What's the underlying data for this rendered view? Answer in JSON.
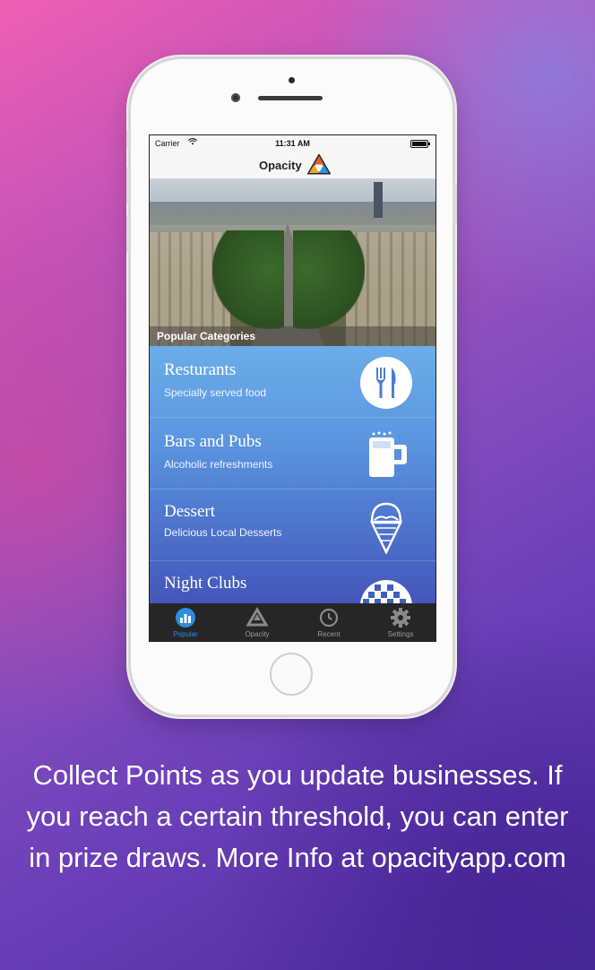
{
  "status_bar": {
    "carrier": "Carrier",
    "time": "11:31 AM"
  },
  "app": {
    "title": "Opacity"
  },
  "hero": {
    "caption": "Popular Categories"
  },
  "categories": [
    {
      "title": "Resturants",
      "subtitle": "Specially served food",
      "icon": "utensils-icon"
    },
    {
      "title": "Bars and Pubs",
      "subtitle": "Alcoholic refreshments",
      "icon": "beer-mug-icon"
    },
    {
      "title": "Dessert",
      "subtitle": "Delicious Local Desserts",
      "icon": "ice-cream-icon"
    },
    {
      "title": "Night Clubs",
      "subtitle": "",
      "icon": "disco-ball-icon"
    }
  ],
  "tabs": [
    {
      "label": "Popular",
      "icon": "popular-icon",
      "active": true
    },
    {
      "label": "Opacity",
      "icon": "opacity-logo-icon",
      "active": false
    },
    {
      "label": "Recent",
      "icon": "clock-icon",
      "active": false
    },
    {
      "label": "Settings",
      "icon": "gear-icon",
      "active": false
    }
  ],
  "promo_text": "Collect Points as you update businesses. If you reach a certain threshold, you can enter in prize draws. More Info at opacityapp.com",
  "colors": {
    "active_tab": "#2f8de0",
    "list_top": "#6aaee8",
    "list_bottom": "#4456b8",
    "tab_bar": "#262626"
  }
}
